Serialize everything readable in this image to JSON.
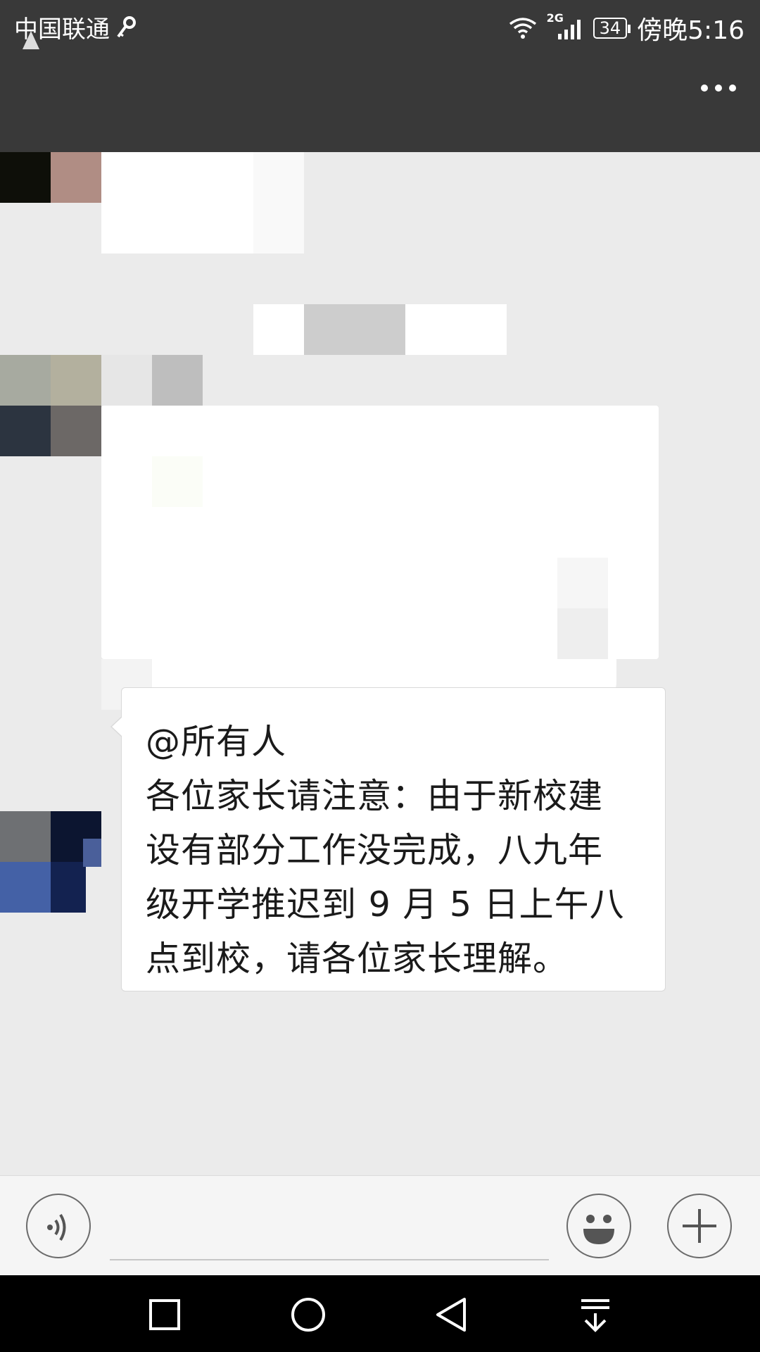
{
  "status_bar": {
    "carrier": "中国联通",
    "network": "2G",
    "battery": "34",
    "time": "傍晚5:16"
  },
  "title_bar": {
    "menu_icon": "more-dots-icon"
  },
  "message": {
    "lines": [
      "@所有人",
      "各位家长请注意：由于新校建",
      "设有部分工作没完成，八九年",
      "级开学推迟到 9 月 5 日上午八",
      "点到校，请各位家长理解。"
    ]
  },
  "input_bar": {
    "voice_icon": "voice-icon",
    "emoji_icon": "emoji-icon",
    "plus_icon": "plus-icon"
  },
  "nav_bar": {
    "icons": [
      "recent-apps-icon",
      "home-icon",
      "back-icon",
      "notification-pull-icon"
    ]
  },
  "colors": {
    "header_bg": "#393939",
    "chat_bg": "#ebebeb",
    "nav_bg": "#000000"
  }
}
